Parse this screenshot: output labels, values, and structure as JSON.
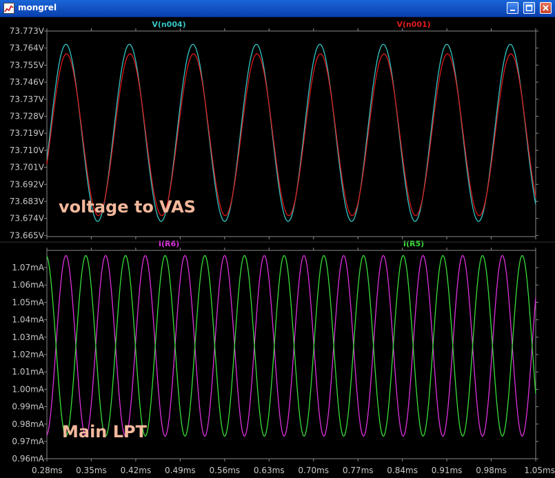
{
  "window": {
    "title": "mongrel",
    "minimize_icon": "minimize-icon",
    "maximize_icon": "maximize-icon",
    "close_icon": "close-icon"
  },
  "colors": {
    "background": "#000000",
    "axis": "#8a8a8a",
    "tick_text": "#c8c8c8",
    "annotation": "#f4b89c"
  },
  "chart_data": [
    {
      "type": "line",
      "title": "",
      "annotation": "voltage to VAS",
      "xlabel": "",
      "ylabel": "",
      "xlim": [
        0.28,
        1.05
      ],
      "ylim": [
        73.665,
        73.773
      ],
      "x_unit": "ms",
      "y_ticks": [
        "73.773V",
        "73.764V",
        "73.755V",
        "73.746V",
        "73.737V",
        "73.728V",
        "73.719V",
        "73.710V",
        "73.701V",
        "73.692V",
        "73.683V",
        "73.674V",
        "73.665V"
      ],
      "grid": false,
      "series": [
        {
          "name": "V(n004)",
          "color": "#35c6c6",
          "waveform": "sine",
          "center": 73.7195,
          "amplitude": 0.0465,
          "period_ms": 0.1,
          "first_peak_ms": 0.31
        },
        {
          "name": "V(n001)",
          "color": "#e01b1b",
          "waveform": "sine",
          "center": 73.7185,
          "amplitude": 0.0425,
          "period_ms": 0.1,
          "first_peak_ms": 0.311
        }
      ]
    },
    {
      "type": "line",
      "title": "",
      "annotation": "Main LPT",
      "xlabel": "",
      "ylabel": "",
      "xlim": [
        0.28,
        1.05
      ],
      "ylim": [
        0.96,
        1.08
      ],
      "x_unit": "ms",
      "y_ticks": [
        "1.07mA",
        "1.06mA",
        "1.05mA",
        "1.04mA",
        "1.03mA",
        "1.02mA",
        "1.01mA",
        "1.00mA",
        "0.99mA",
        "0.98mA",
        "0.97mA",
        "0.96mA"
      ],
      "x_ticks": [
        "0.28ms",
        "0.35ms",
        "0.42ms",
        "0.49ms",
        "0.56ms",
        "0.63ms",
        "0.70ms",
        "0.77ms",
        "0.84ms",
        "0.91ms",
        "0.98ms",
        "1.05ms"
      ],
      "grid": false,
      "series": [
        {
          "name": "I(R6)",
          "color": "#e030e0",
          "waveform": "sine",
          "center": 1.025,
          "amplitude": 0.052,
          "period_ms": 0.0625,
          "first_peak_ms": 0.31
        },
        {
          "name": "I(R5)",
          "color": "#39e039",
          "waveform": "sine",
          "center": 1.025,
          "amplitude": 0.052,
          "period_ms": 0.0625,
          "first_peak_ms": 0.3413
        }
      ]
    }
  ]
}
